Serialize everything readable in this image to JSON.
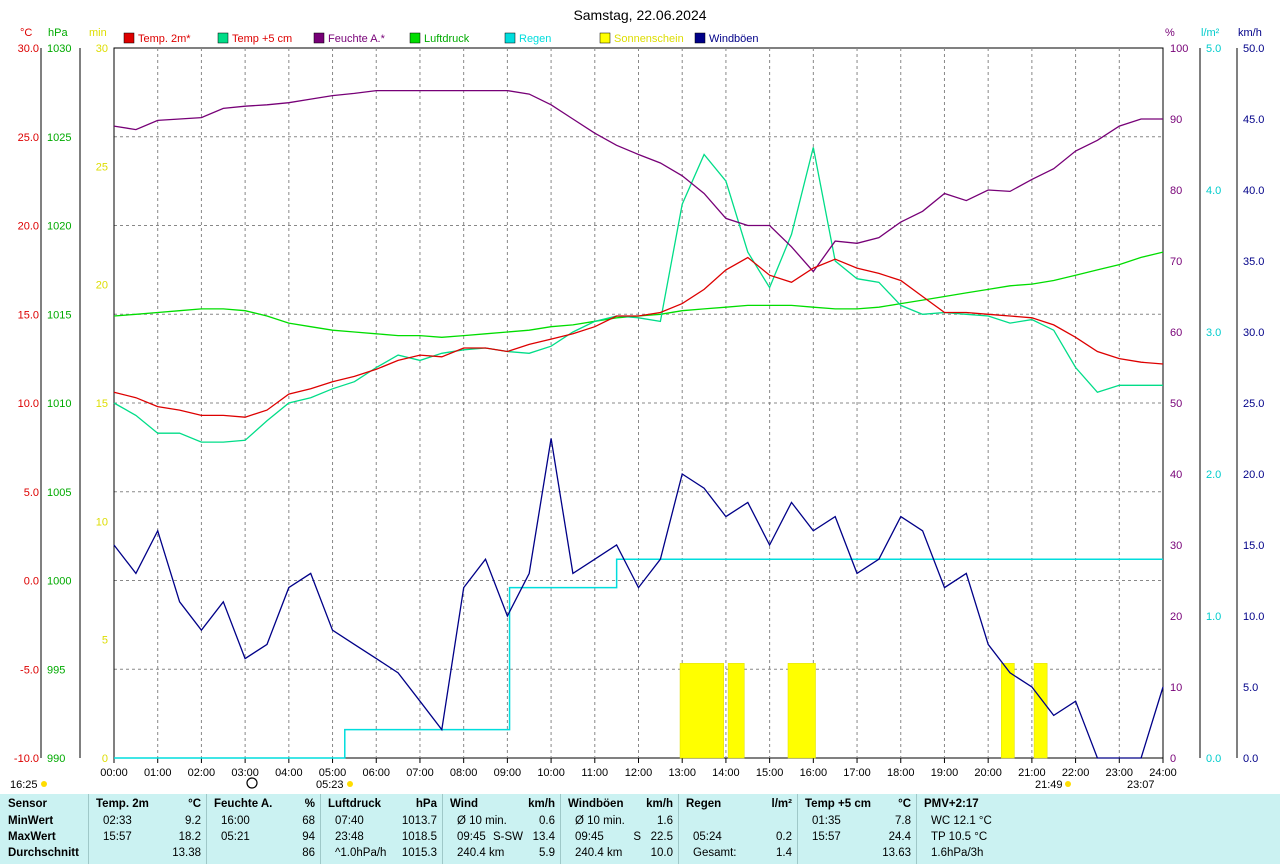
{
  "title": "Samstag, 22.06.2024",
  "colors": {
    "temp2m": "#dd0000",
    "temp5cm": "#00dd88",
    "humidity": "#770077",
    "pressure": "#00dd00",
    "rain": "#00dddd",
    "sunshine": "#ffff00",
    "gust": "#000088",
    "grid": "#808080",
    "stats_bg": "#cbf2f2"
  },
  "legend": [
    {
      "label": "Temp. 2m*",
      "color": "#dd0000",
      "text_color": "#dd0000"
    },
    {
      "label": "Temp +5 cm",
      "color": "#00dd88",
      "text_color": "#dd0000"
    },
    {
      "label": "Feuchte A.*",
      "color": "#770077",
      "text_color": "#770077"
    },
    {
      "label": "Luftdruck",
      "color": "#00dd00",
      "text_color": "#00aa00"
    },
    {
      "label": "Regen",
      "color": "#00dddd",
      "text_color": "#00dddd"
    },
    {
      "label": "Sonnenschein",
      "color": "#ffff00",
      "text_color": "#dddd00"
    },
    {
      "label": "Windböen",
      "color": "#000088",
      "text_color": "#000088"
    }
  ],
  "axes": {
    "temp": {
      "unit": "°C",
      "ticks": [
        "30.0",
        "25.0",
        "20.0",
        "15.0",
        "10.0",
        "5.0",
        "0.0",
        "-5.0",
        "-10.0"
      ]
    },
    "pressure": {
      "unit": "hPa",
      "ticks": [
        "1030",
        "1025",
        "1020",
        "1015",
        "1010",
        "1005",
        "1000",
        "995",
        "990"
      ]
    },
    "sunshine": {
      "unit": "min",
      "ticks": [
        "30",
        "25",
        "20",
        "15",
        "10",
        "5",
        "0"
      ]
    },
    "humidity": {
      "unit": "%",
      "ticks": [
        "100",
        "90",
        "80",
        "70",
        "60",
        "50",
        "40",
        "30",
        "20",
        "10",
        "0"
      ]
    },
    "rain": {
      "unit": "l/m²",
      "ticks": [
        "5.0",
        "4.0",
        "3.0",
        "2.0",
        "1.0",
        "0.0"
      ]
    },
    "wind": {
      "unit": "km/h",
      "ticks": [
        "50.0",
        "45.0",
        "40.0",
        "35.0",
        "30.0",
        "25.0",
        "20.0",
        "15.0",
        "10.0",
        "5.0",
        "0.0"
      ]
    },
    "time_ticks": [
      "00:00",
      "01:00",
      "02:00",
      "03:00",
      "04:00",
      "05:00",
      "06:00",
      "07:00",
      "08:00",
      "09:00",
      "10:00",
      "11:00",
      "12:00",
      "13:00",
      "14:00",
      "15:00",
      "16:00",
      "17:00",
      "18:00",
      "19:00",
      "20:00",
      "21:00",
      "22:00",
      "23:00",
      "24:00"
    ]
  },
  "sun_moon": {
    "left_time": "16:25",
    "sunrise": "05:23",
    "sunset": "21:49",
    "moon_time": "23:07"
  },
  "chart_data": {
    "type": "line",
    "title": "Samstag, 22.06.2024",
    "x_unit": "hour",
    "xlim": [
      0,
      24
    ],
    "series": [
      {
        "name": "Temp. 2m*",
        "axis": "°C",
        "ylim": [
          -10,
          30
        ],
        "x": [
          0,
          0.5,
          1,
          1.5,
          2,
          2.5,
          3,
          3.5,
          4,
          4.5,
          5,
          5.5,
          6,
          6.5,
          7,
          7.5,
          8,
          8.5,
          9,
          9.5,
          10,
          10.5,
          11,
          11.5,
          12,
          12.5,
          13,
          13.5,
          14,
          14.5,
          15,
          15.5,
          16,
          16.5,
          17,
          17.5,
          18,
          18.5,
          19,
          19.5,
          20,
          20.5,
          21,
          21.5,
          22,
          22.5,
          23,
          23.5,
          24
        ],
        "values": [
          10.6,
          10.3,
          9.8,
          9.6,
          9.3,
          9.3,
          9.2,
          9.6,
          10.5,
          10.8,
          11.2,
          11.5,
          11.9,
          12.4,
          12.7,
          12.6,
          13.1,
          13.1,
          12.9,
          13.3,
          13.6,
          13.9,
          14.3,
          14.9,
          14.9,
          15.1,
          15.6,
          16.4,
          17.5,
          18.2,
          17.2,
          16.8,
          17.6,
          18.1,
          17.6,
          17.3,
          16.9,
          16.0,
          15.1,
          15.1,
          15.0,
          14.9,
          14.8,
          14.4,
          13.7,
          12.9,
          12.5,
          12.3,
          12.2
        ]
      },
      {
        "name": "Temp +5 cm",
        "axis": "°C",
        "ylim": [
          -10,
          30
        ],
        "x": [
          0,
          0.5,
          1,
          1.5,
          2,
          2.5,
          3,
          3.5,
          4,
          4.5,
          5,
          5.5,
          6,
          6.5,
          7,
          7.5,
          8,
          8.5,
          9,
          9.5,
          10,
          10.5,
          11,
          11.5,
          12,
          12.5,
          13,
          13.5,
          14,
          14.5,
          15,
          15.5,
          16,
          16.5,
          17,
          17.5,
          18,
          18.5,
          19,
          19.5,
          20,
          20.5,
          21,
          21.5,
          22,
          22.5,
          23,
          23.5,
          24
        ],
        "values": [
          10.0,
          9.3,
          8.3,
          8.3,
          7.8,
          7.8,
          7.9,
          9.0,
          10.0,
          10.3,
          10.8,
          11.2,
          12.0,
          12.7,
          12.4,
          12.8,
          13.0,
          13.1,
          12.9,
          12.8,
          13.2,
          14.0,
          14.6,
          14.9,
          14.8,
          14.6,
          21.2,
          24.0,
          22.5,
          18.5,
          16.5,
          19.5,
          24.4,
          18.0,
          17.0,
          16.8,
          15.5,
          15.0,
          15.1,
          15.0,
          14.9,
          14.5,
          14.7,
          14.1,
          12.0,
          10.6,
          11.0,
          11.0,
          11.0
        ]
      },
      {
        "name": "Feuchte A.*",
        "axis": "%",
        "ylim": [
          0,
          100
        ],
        "x": [
          0,
          0.5,
          1,
          1.5,
          2,
          2.5,
          3,
          3.5,
          4,
          4.5,
          5,
          5.5,
          6,
          6.5,
          7,
          7.5,
          8,
          8.5,
          9,
          9.5,
          10,
          10.5,
          11,
          11.5,
          12,
          12.5,
          13,
          13.5,
          14,
          14.5,
          15,
          15.5,
          16,
          16.5,
          17,
          17.5,
          18,
          18.5,
          19,
          19.5,
          20,
          20.5,
          21,
          21.5,
          22,
          22.5,
          23,
          23.5,
          24
        ],
        "values": [
          89,
          88.5,
          89.8,
          90,
          90.2,
          91.5,
          91.8,
          92,
          92.3,
          92.8,
          93.3,
          93.6,
          94,
          94,
          94,
          94,
          94,
          94,
          94,
          93.5,
          92,
          90,
          88,
          86.3,
          85,
          83.8,
          82,
          79.5,
          76,
          75,
          75,
          72,
          68.5,
          72.8,
          72.5,
          73.3,
          75.5,
          77,
          79.5,
          78.5,
          80,
          79.8,
          81.5,
          83,
          85.5,
          87,
          89,
          90,
          90
        ]
      },
      {
        "name": "Luftdruck",
        "axis": "hPa",
        "ylim": [
          990,
          1030
        ],
        "x": [
          0,
          0.5,
          1,
          1.5,
          2,
          2.5,
          3,
          3.5,
          4,
          4.5,
          5,
          5.5,
          6,
          6.5,
          7,
          7.5,
          8,
          8.5,
          9,
          9.5,
          10,
          10.5,
          11,
          11.5,
          12,
          12.5,
          13,
          13.5,
          14,
          14.5,
          15,
          15.5,
          16,
          16.5,
          17,
          17.5,
          18,
          18.5,
          19,
          19.5,
          20,
          20.5,
          21,
          21.5,
          22,
          22.5,
          23,
          23.5,
          24
        ],
        "values": [
          1014.9,
          1015.0,
          1015.1,
          1015.2,
          1015.3,
          1015.3,
          1015.2,
          1014.9,
          1014.5,
          1014.3,
          1014.1,
          1014.0,
          1013.9,
          1013.8,
          1013.8,
          1013.7,
          1013.8,
          1013.9,
          1014.0,
          1014.1,
          1014.3,
          1014.4,
          1014.6,
          1014.8,
          1014.9,
          1015.0,
          1015.2,
          1015.3,
          1015.4,
          1015.5,
          1015.5,
          1015.5,
          1015.4,
          1015.3,
          1015.3,
          1015.4,
          1015.6,
          1015.8,
          1016.0,
          1016.2,
          1016.4,
          1016.6,
          1016.7,
          1016.9,
          1017.2,
          1017.5,
          1017.8,
          1018.2,
          1018.5
        ]
      },
      {
        "name": "Regen",
        "axis": "l/m²",
        "ylim": [
          0,
          5
        ],
        "kind": "step",
        "x": [
          0,
          5.28,
          5.4,
          8.95,
          9.05,
          9.2,
          11.0,
          11.5,
          24
        ],
        "values": [
          0,
          0.2,
          0.2,
          0.2,
          1.2,
          1.2,
          1.2,
          1.4,
          1.4
        ]
      },
      {
        "name": "Sonnenschein",
        "axis": "min",
        "ylim": [
          0,
          30
        ],
        "kind": "bars",
        "intervals": [
          [
            12.95,
            13.95
          ],
          [
            14.05,
            14.42
          ],
          [
            15.42,
            16.05
          ],
          [
            20.3,
            20.6
          ],
          [
            21.05,
            21.35
          ]
        ],
        "values": [
          4,
          4,
          4,
          4,
          4
        ]
      },
      {
        "name": "Windböen",
        "axis": "km/h",
        "ylim": [
          0,
          50
        ],
        "x": [
          0,
          0.5,
          1,
          1.5,
          2,
          2.5,
          3,
          3.5,
          4,
          4.5,
          5,
          5.5,
          6,
          6.5,
          7,
          7.5,
          8,
          8.5,
          9,
          9.5,
          10,
          10.5,
          11,
          11.5,
          12,
          12.5,
          13,
          13.5,
          14,
          14.5,
          15,
          15.5,
          16,
          16.5,
          17,
          17.5,
          18,
          18.5,
          19,
          19.5,
          20,
          20.5,
          21,
          21.5,
          22,
          22.5,
          23,
          23.5,
          24
        ],
        "values": [
          15,
          13,
          16,
          11,
          9,
          11,
          7,
          8,
          12,
          13,
          9,
          8,
          7,
          6,
          4,
          2,
          12,
          14,
          10,
          13,
          22.5,
          13,
          14,
          15,
          12,
          14,
          20,
          19,
          17,
          18,
          15,
          18,
          16,
          17,
          13,
          14,
          17,
          16,
          12,
          13,
          8,
          6,
          5,
          3,
          4,
          0,
          0,
          0,
          5
        ]
      }
    ]
  },
  "stats": {
    "label_col": {
      "header": "Sensor",
      "rows": [
        "MinWert",
        "MaxWert",
        "Durchschnitt"
      ]
    },
    "columns": [
      {
        "name": "Temp. 2m",
        "unit": "°C",
        "rows": [
          [
            "02:33",
            "",
            "9.2"
          ],
          [
            "15:57",
            "",
            "18.2"
          ],
          [
            "",
            "",
            "13.38"
          ]
        ]
      },
      {
        "name": "Feuchte A.",
        "unit": "%",
        "rows": [
          [
            "16:00",
            "",
            "68"
          ],
          [
            "05:21",
            "",
            "94"
          ],
          [
            "",
            "",
            "86"
          ]
        ]
      },
      {
        "name": "Luftdruck",
        "unit": "hPa",
        "rows": [
          [
            "07:40",
            "",
            "1013.7"
          ],
          [
            "23:48",
            "",
            "1018.5"
          ],
          [
            "^1.0hPa/h",
            "",
            "1015.3"
          ]
        ]
      },
      {
        "name": "Wind",
        "unit": "km/h",
        "rows": [
          [
            "Ø 10 min.",
            "",
            "0.6"
          ],
          [
            "09:45",
            "S-SW",
            "13.4"
          ],
          [
            "240.4 km",
            "",
            "5.9"
          ]
        ]
      },
      {
        "name": "Windböen",
        "unit": "km/h",
        "rows": [
          [
            "Ø 10 min.",
            "",
            "1.6"
          ],
          [
            "09:45",
            "S",
            "22.5"
          ],
          [
            "240.4 km",
            "",
            "10.0"
          ]
        ]
      },
      {
        "name": "Regen",
        "unit": "l/m²",
        "rows": [
          [
            "",
            "",
            ""
          ],
          [
            "05:24",
            "",
            "0.2"
          ],
          [
            "Gesamt:",
            "",
            "1.4"
          ]
        ]
      },
      {
        "name": "Temp +5 cm",
        "unit": "°C",
        "rows": [
          [
            "01:35",
            "",
            "7.8"
          ],
          [
            "15:57",
            "",
            "24.4"
          ],
          [
            "",
            "",
            "13.63"
          ]
        ]
      },
      {
        "name": "PMV+2:17",
        "unit": "",
        "rows": [
          [
            "WC 12.1 °C",
            "",
            ""
          ],
          [
            "TP 10.5 °C",
            "",
            ""
          ],
          [
            "1.6hPa/3h",
            "",
            ""
          ]
        ]
      }
    ]
  }
}
